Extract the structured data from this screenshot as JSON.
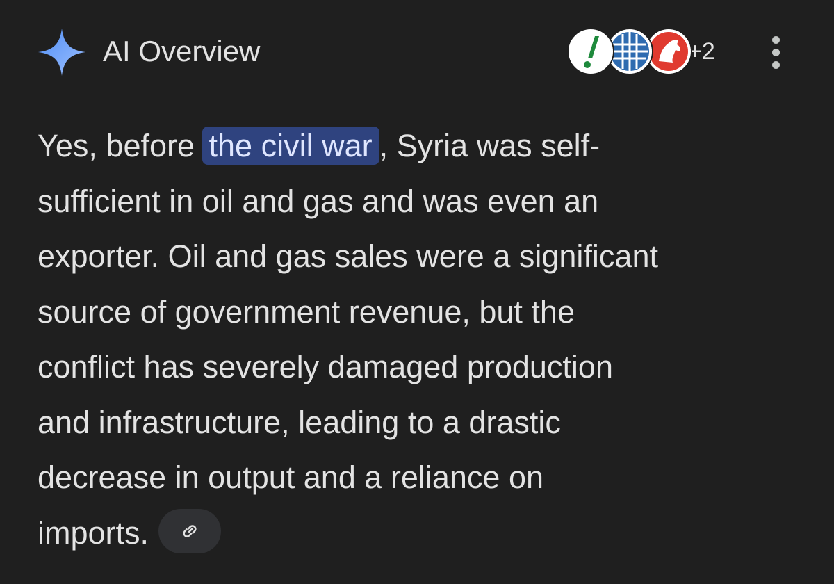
{
  "overview": {
    "title": "AI Overview",
    "icon": "sparkle-icon",
    "accent_color": "#8ab4f8"
  },
  "sources": {
    "favicons": [
      "exclamation-favicon",
      "globe-grid-favicon",
      "red-horse-favicon"
    ],
    "more_count": "+2"
  },
  "menu": {
    "icon": "more-vert-icon"
  },
  "answer": {
    "lines": [
      {
        "before": "Yes, before ",
        "highlight": "the civil war",
        "after": ", Syria was self-"
      },
      {
        "text": "sufficient in oil and gas and was even an"
      },
      {
        "text": "exporter. Oil and gas sales were a significant"
      },
      {
        "text": "source of government revenue, but the"
      },
      {
        "text": "conflict has severely damaged production"
      },
      {
        "text": "and infrastructure, leading to a drastic"
      },
      {
        "text": "decrease in output and a reliance on"
      },
      {
        "text": "imports."
      }
    ],
    "link_icon": "link-icon"
  },
  "colors": {
    "background": "#1f1f1f",
    "text": "#e3e3e3",
    "highlight_bg": "#2f437f",
    "chip_bg": "#303134"
  }
}
